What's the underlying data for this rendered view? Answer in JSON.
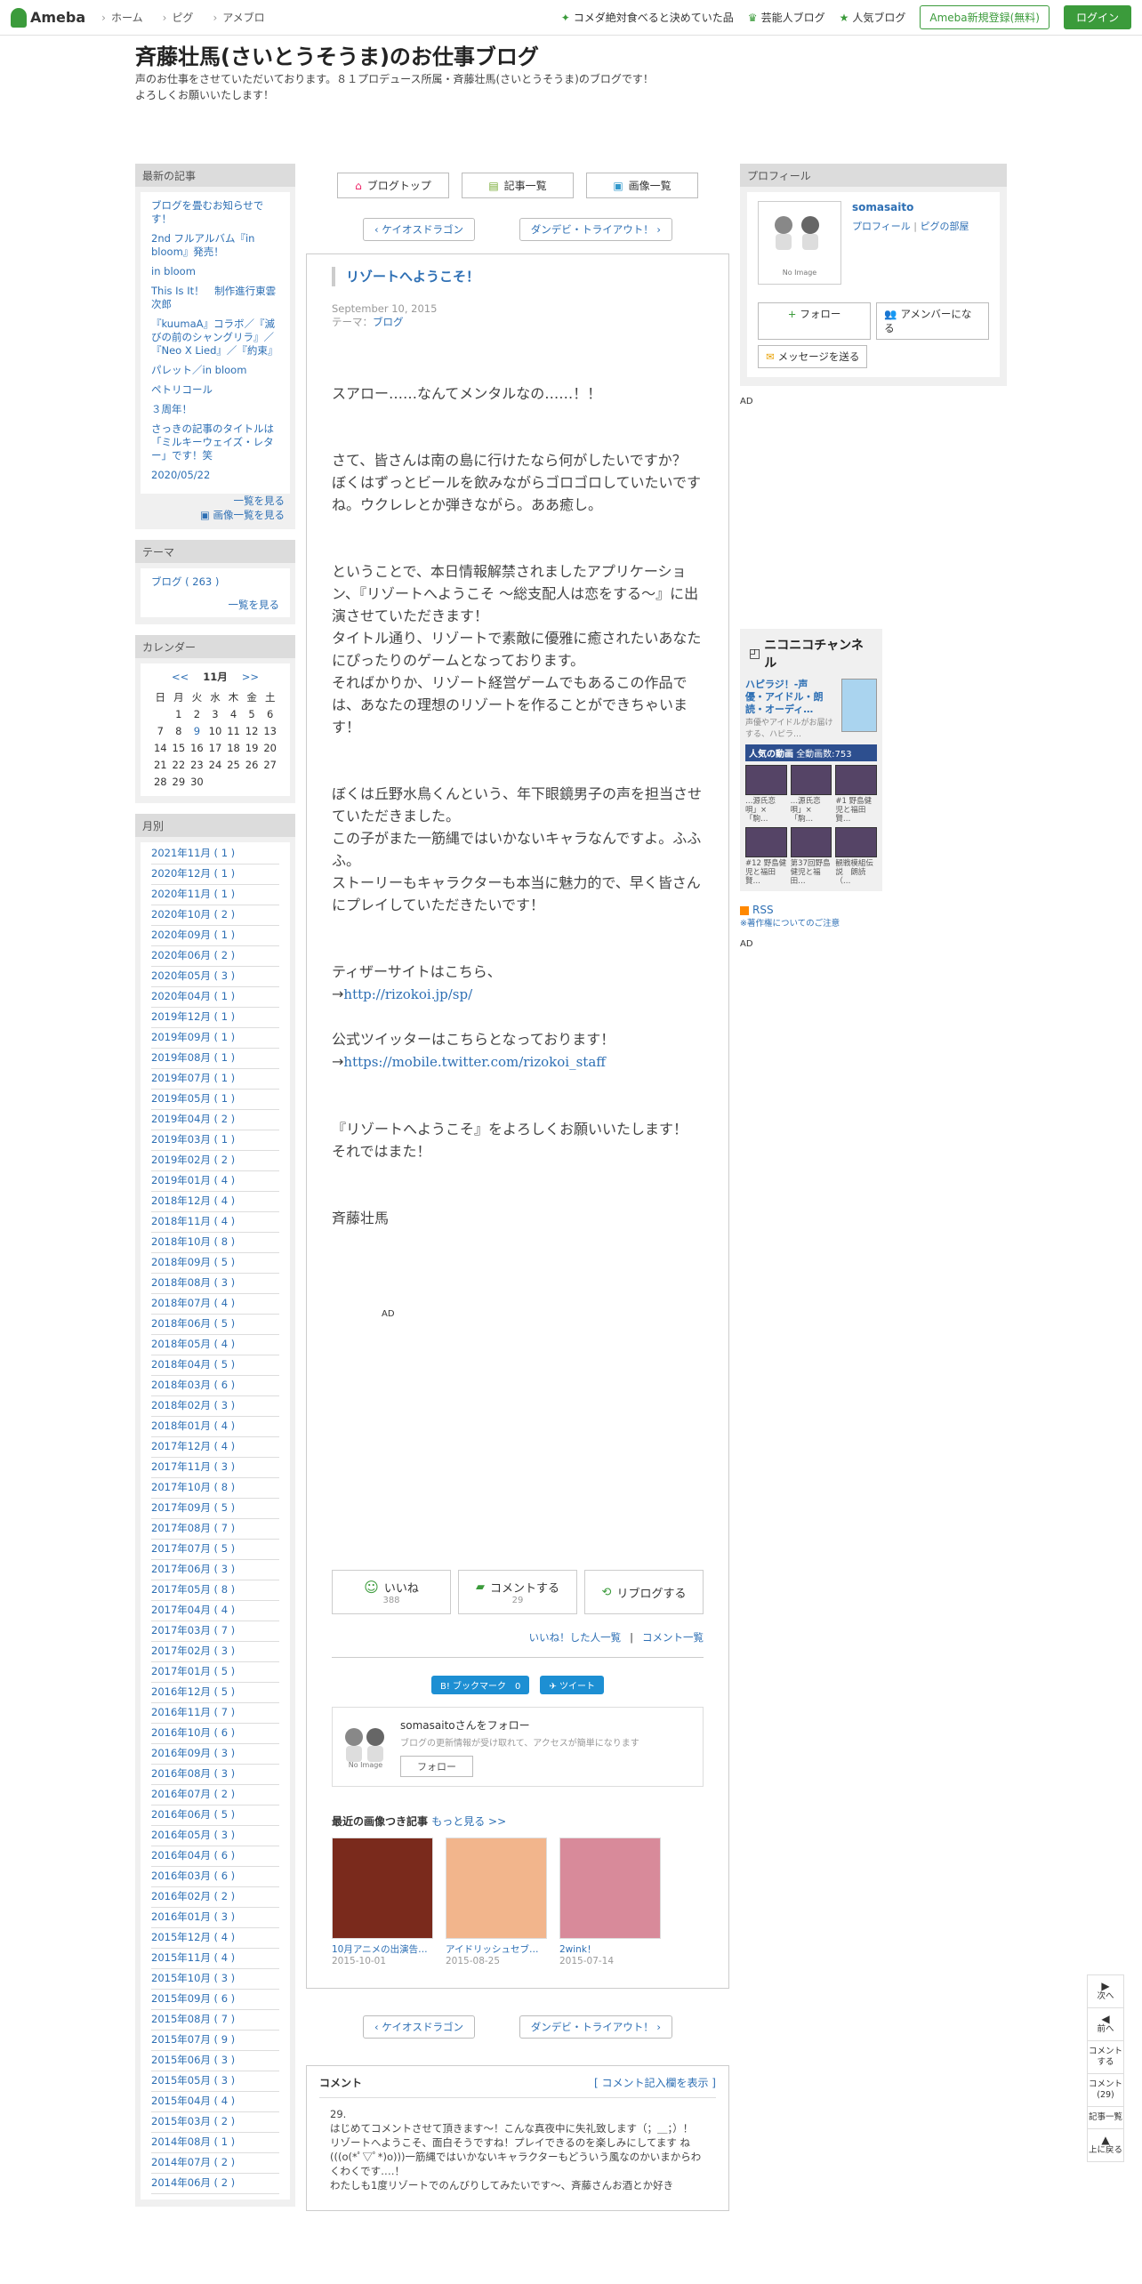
{
  "topbar": {
    "brand": "Ameba",
    "nav": [
      "ホーム",
      "ピグ",
      "アメブロ"
    ],
    "right_links": [
      "コメダ絶対食べると決めていた品",
      "芸能人ブログ",
      "人気ブログ"
    ],
    "register": "Ameba新規登録(無料)",
    "login": "ログイン"
  },
  "header": {
    "title": "斉藤壮馬(さいとうそうま)のお仕事ブログ",
    "desc1": "声のお仕事をさせていただいております。８１プロデュース所属・斉藤壮馬(さいとうそうま)のブログです！",
    "desc2": "よろしくお願いいたします！"
  },
  "sidebar": {
    "recent_title": "最新の記事",
    "recent": [
      "ブログを畳むお知らせです！",
      "2nd フルアルバム『in bloom』発売！",
      "in bloom",
      "This Is It！　制作進行東雲次郎",
      "『kuumaA』コラボ／『滅びの前のシャングリラ』／『Neo X Lied』／『約束』",
      "パレット／in bloom",
      "ペトリコール",
      "３周年！",
      "さっきの記事のタイトルは「ミルキーウェイズ・レター」です！笑",
      "2020/05/22"
    ],
    "recent_more": "一覧を見る",
    "recent_img_more": "画像一覧を見る",
    "theme_title": "テーマ",
    "theme": "ブログ ( 263 )",
    "theme_more": "一覧を見る",
    "cal_title": "カレンダー",
    "cal_prev": "<<",
    "cal_month": "11月",
    "cal_next": ">>",
    "cal_days": [
      "日",
      "月",
      "火",
      "水",
      "木",
      "金",
      "土"
    ],
    "cal_rows": [
      [
        "",
        "1",
        "2",
        "3",
        "4",
        "5",
        "6"
      ],
      [
        "7",
        "8",
        "9",
        "10",
        "11",
        "12",
        "13"
      ],
      [
        "14",
        "15",
        "16",
        "17",
        "18",
        "19",
        "20"
      ],
      [
        "21",
        "22",
        "23",
        "24",
        "25",
        "26",
        "27"
      ],
      [
        "28",
        "29",
        "30",
        "",
        "",
        "",
        ""
      ]
    ],
    "arch_title": "月別",
    "archive": [
      "2021年11月 ( 1 )",
      "2020年12月 ( 1 )",
      "2020年11月 ( 1 )",
      "2020年10月 ( 2 )",
      "2020年09月 ( 1 )",
      "2020年06月 ( 2 )",
      "2020年05月 ( 3 )",
      "2020年04月 ( 1 )",
      "2019年12月 ( 1 )",
      "2019年09月 ( 1 )",
      "2019年08月 ( 1 )",
      "2019年07月 ( 1 )",
      "2019年05月 ( 1 )",
      "2019年04月 ( 2 )",
      "2019年03月 ( 1 )",
      "2019年02月 ( 2 )",
      "2019年01月 ( 4 )",
      "2018年12月 ( 4 )",
      "2018年11月 ( 4 )",
      "2018年10月 ( 8 )",
      "2018年09月 ( 5 )",
      "2018年08月 ( 3 )",
      "2018年07月 ( 4 )",
      "2018年06月 ( 5 )",
      "2018年05月 ( 4 )",
      "2018年04月 ( 5 )",
      "2018年03月 ( 6 )",
      "2018年02月 ( 3 )",
      "2018年01月 ( 4 )",
      "2017年12月 ( 4 )",
      "2017年11月 ( 3 )",
      "2017年10月 ( 8 )",
      "2017年09月 ( 5 )",
      "2017年08月 ( 7 )",
      "2017年07月 ( 5 )",
      "2017年06月 ( 3 )",
      "2017年05月 ( 8 )",
      "2017年04月 ( 4 )",
      "2017年03月 ( 7 )",
      "2017年02月 ( 3 )",
      "2017年01月 ( 5 )",
      "2016年12月 ( 5 )",
      "2016年11月 ( 7 )",
      "2016年10月 ( 6 )",
      "2016年09月 ( 3 )",
      "2016年08月 ( 3 )",
      "2016年07月 ( 2 )",
      "2016年06月 ( 5 )",
      "2016年05月 ( 3 )",
      "2016年04月 ( 6 )",
      "2016年03月 ( 6 )",
      "2016年02月 ( 2 )",
      "2016年01月 ( 3 )",
      "2015年12月 ( 4 )",
      "2015年11月 ( 4 )",
      "2015年10月 ( 3 )",
      "2015年09月 ( 6 )",
      "2015年08月 ( 7 )",
      "2015年07月 ( 9 )",
      "2015年06月 ( 3 )",
      "2015年05月 ( 3 )",
      "2015年04月 ( 4 )",
      "2015年03月 ( 2 )",
      "2014年08月 ( 1 )",
      "2014年07月 ( 2 )",
      "2014年06月 ( 2 )"
    ]
  },
  "main": {
    "tabs": [
      "ブログトップ",
      "記事一覧",
      "画像一覧"
    ],
    "prev": "ケイオスドラゴン",
    "next": "ダンデビ・トライアウト！",
    "title": "リゾートへようこそ！",
    "date": "September 10, 2015",
    "theme_label": "テーマ：",
    "theme": "ブログ",
    "p1": "スアロー……なんてメンタルなの……！！",
    "p2a": "さて、皆さんは南の島に行けたなら何がしたいですか？",
    "p2b": "ぼくはずっとビールを飲みながらゴロゴロしていたいですね。ウクレレとか弾きながら。ああ癒し。",
    "p3a": "ということで、本日情報解禁されましたアプリケーション、『リゾートへようこそ ～総支配人は恋をする～』に出演させていただきます！",
    "p3b": "タイトル通り、リゾートで素敵に優雅に癒されたいあなたにぴったりのゲームとなっております。",
    "p3c": "そればかりか、リゾート経営ゲームでもあるこの作品では、あなたの理想のリゾートを作ることができちゃいます！",
    "p4a": "ぼくは丘野水鳥くんという、年下眼鏡男子の声を担当させていただきました。",
    "p4b": "この子がまた一筋縄ではいかないキャラなんですよ。ふふふ。",
    "p4c": "ストーリーもキャラクターも本当に魅力的で、早く皆さんにプレイしていただきたいです！",
    "p5a": "ティザーサイトはこちら、",
    "link1_prefix": "→",
    "link1": "http://rizokoi.jp/sp/",
    "p6a": "公式ツイッターはこちらとなっております！",
    "link2_prefix": "→",
    "link2": "https://mobile.twitter.com/rizokoi_staff",
    "p7a": "『リゾートへようこそ』をよろしくお願いいたします！",
    "p7b": "それではまた！",
    "sign": "斉藤壮馬",
    "ad": "AD",
    "like": "いいね",
    "like_count": "388",
    "comment": "コメントする",
    "comment_count": "29",
    "reblog": "リブログする",
    "liked_list": "いいね！した人一覧",
    "sep": "|",
    "comment_list": "コメント一覧",
    "hatena": "B! ブックマーク　0",
    "tweet": "ツイート",
    "follow_name": "somasaitoさんをフォロー",
    "follow_desc": "ブログの更新情報が受け取れて、アクセスが簡単になります",
    "follow_btn": "フォロー",
    "noimage": "No Image",
    "recent_img_title": "最近の画像つき記事",
    "recent_img_more": "もっと見る >>",
    "thumbs": [
      {
        "title": "10月アニメの出演告…",
        "date": "2015-10-01",
        "color": "#7a2a1c"
      },
      {
        "title": "アイドリッシュセブ…",
        "date": "2015-08-25",
        "color": "#f2b58c"
      },
      {
        "title": "2wink！",
        "date": "2015-07-14",
        "color": "#d88a9a"
      }
    ],
    "comments_title": "コメント",
    "comments_show": "[ コメント記入欄を表示 ]",
    "c_num": "29.",
    "c1": "はじめてコメントさせて頂きます～！こんな真夜中に失礼致します（；＿；）！",
    "c2": "リゾートへようこそ、面白そうですね！プレイできるのを楽しみにしてます ね(((o(*ﾟ▽ﾟ*)o)))一筋縄ではいかないキャラクターもどういう風なのかいまからわくわくです‥‥！",
    "c3": "わたしも1度リゾートでのんびりしてみたいです～、斉藤さんお酒とか好き"
  },
  "profile": {
    "title": "プロフィール",
    "name": "somasaito",
    "link1": "プロフィール",
    "sep": "|",
    "link2": "ピグの部屋",
    "follow": "フォロー",
    "member": "アメンバーになる",
    "message": "メッセージを送る",
    "ad": "AD",
    "nico_title": "ニコニコチャンネル",
    "nico_feat": "ハピラジ！-声優・アイドル・朗読・オーディ…",
    "nico_feat_desc": "声優やアイドルがお届けする、ハピラ…",
    "nico_bar": "人気の動画",
    "nico_total": "全動画数:753",
    "nico_items": [
      "…源氏恋唄」×「駒…",
      "…源氏恋唄」×「駒…",
      "#1 野島健児と福田賢…",
      "#12 野島健児と福田賢…",
      "第37回野島健児と福田…",
      "観戦模組伝説　朗読（…"
    ],
    "rss": "RSS",
    "rss_note": "※著作権についてのご注意",
    "ad2": "AD"
  },
  "floatnav": {
    "next": "次へ",
    "prev": "前へ",
    "comment": "コメントする",
    "comment_count": "コメント(29)",
    "list": "記事一覧",
    "top": "上に戻る"
  }
}
